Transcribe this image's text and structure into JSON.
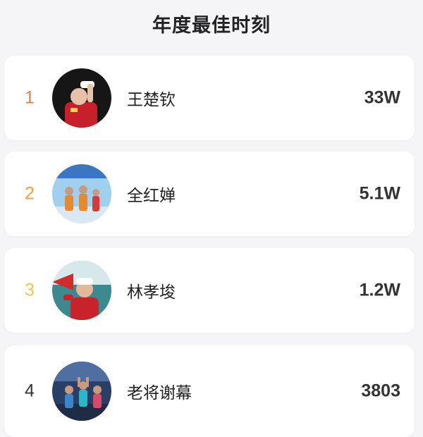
{
  "header": {
    "title": "年度最佳时刻"
  },
  "ranking": [
    {
      "rank": "1",
      "name": "王楚钦",
      "count": "33W",
      "rank_color": "#f07a3e"
    },
    {
      "rank": "2",
      "name": "全红婵",
      "count": "5.1W",
      "rank_color": "#f29e3e"
    },
    {
      "rank": "3",
      "name": "林孝埈",
      "count": "1.2W",
      "rank_color": "#f0c448"
    },
    {
      "rank": "4",
      "name": "老将谢幕",
      "count": "3803",
      "rank_color": "#333333"
    }
  ]
}
